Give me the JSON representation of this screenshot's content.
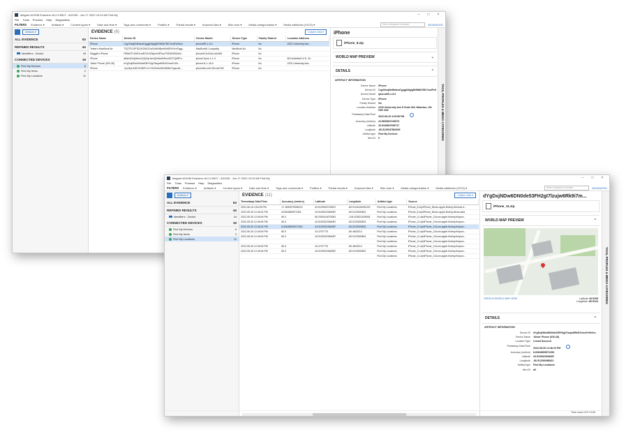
{
  "colors": {
    "accent": "#2a6ebd",
    "selected_row": "#cfe2f7",
    "map_pin": "#d33333"
  },
  "window1": {
    "title": "Magnet AXIOM Examine v6.0.0.5527 - AXIOM - Jun 17 2022 19:10:08 Find My",
    "menu": [
      "File",
      "Tools",
      "Process",
      "Help",
      "Diagnostics"
    ],
    "filters_label": "FILTERS",
    "filters": [
      "Evidence ▾",
      "Artifacts ▾",
      "Content types ▾",
      "Date and time ▾",
      "Tags and comments ▾",
      "Profiles ▾",
      "Partial results ▾",
      "Keyword lists ▾",
      "Skin tone ▾",
      "Media categorization ▾",
      "Media attributes (VICS) ▾"
    ],
    "search_placeholder": "Enter a keyword to search",
    "advanced": "ADVANCED",
    "artifacts_btn": "Artifacts ▾",
    "left": {
      "all_evidence": {
        "label": "ALL EVIDENCE",
        "count": "63"
      },
      "refined": {
        "label": "REFINED RESULTS",
        "count": "44"
      },
      "refined_items": [
        {
          "label": "Identifiers - Device",
          "count": "44"
        }
      ],
      "connected": {
        "label": "CONNECTED DEVICES",
        "count": "19"
      },
      "connected_items": [
        {
          "label": "Find My Devices",
          "count": "6"
        },
        {
          "label": "Find My Items",
          "count": "2"
        },
        {
          "label": "Find My Locations",
          "count": "11"
        }
      ]
    },
    "evidence": {
      "title": "EVIDENCE",
      "count": "(6)",
      "column_view": "Column view ▾",
      "columns": [
        "Device Name",
        "Device ID",
        "Device Model",
        "Device Type",
        "Family Shared",
        "Location Address"
      ],
      "rows": [
        [
          "iPhone",
          "CqyXhsqBnIfhdnaCjyggNiIgIgNHNMk78K7mulFvKkUo",
          "iphone8S-1-9-0",
          "iPhone",
          "No",
          "2220 University Ave..."
        ],
        [
          "Tester's MacBook Air",
          "T2QTSCdPTjDJKZbDJGaGc5hWljmMIx8DVhVrnTogg...",
          "MacBook6,1-capacity",
          "MacBook Air",
          "No",
          ""
        ],
        [
          "Maggie's iPhone",
          "PBWdTCUMGvmB7UUVWjcmV8FtuuTDDW3fXlZw9...",
          "iphone8-3x3x3c-b4e3b8",
          "iPhone",
          "No",
          ""
        ],
        [
          "iPhone",
          "aBah1b2aj3bnoXQQ2yUzmQhi9wsRNvn4ZZTQbRPc...",
          "iphone7plus-1-1-0",
          "iPhone",
          "No",
          "55 Northfield Dr E, W..."
        ],
        [
          "'Alicia' Phone (iOS-28)",
          "dYgDxjNDw0N0de53FH2gI7lzujw6Rk9i7mnsFvKh...",
          "iphone11-1-18-0",
          "iPhone",
          "No",
          "2220 University Ave..."
        ],
        [
          "iPhone",
          "+qVI4pUhW7eHWPcYn+N/2Gs3z5kXAB8eYhgcuvfL...",
          "iphone8s-e4e7e8-e4e7e8",
          "iPhone",
          "No",
          ""
        ]
      ]
    },
    "right": {
      "title": "iPhone",
      "file": "iPhone_8.zip",
      "map_preview": "WORLD MAP PREVIEW",
      "details": "DETAILS",
      "artifact_info": "ARTIFACT INFORMATION",
      "fields": [
        {
          "k": "Device Name",
          "v": "iPhone"
        },
        {
          "k": "Device ID",
          "v": "CqyXhsqBnIfhdnaCjyggNiIgIgNHNMk78K7mulFvKk="
        },
        {
          "k": "Device Model",
          "v": "iphone8S-1-9-0"
        },
        {
          "k": "Device Type",
          "v": "iPhone"
        },
        {
          "k": "Family Shared",
          "v": "No"
        },
        {
          "k": "Location Address",
          "v": "2220 University Ave E Suite 300, Waterloo, ON N2K 0A8"
        },
        {
          "k": "Timestamp Date/Time",
          "v": "2022-06-15 4:29:59 PM"
        },
        {
          "k": "Accuracy (meters)",
          "v": "22.8693837195373"
        },
        {
          "k": "Latitude",
          "v": "43.5169847995717"
        },
        {
          "k": "Longitude",
          "v": "-80.5125947861599"
        },
        {
          "k": "Artifact type",
          "v": "Find My Devices"
        },
        {
          "k": "Item ID",
          "v": "0"
        }
      ]
    },
    "vtab": "TAGS, PROFILES & MEDIA CATEGORIES"
  },
  "window2": {
    "title": "Magnet AXIOM Examine v6.0.0.5527 - AXIOM - Jun 17 2022 19:10:08 Find My",
    "menu": [
      "File",
      "Tools",
      "Process",
      "Help",
      "Diagnostics"
    ],
    "filters_label": "FILTERS",
    "filters": [
      "Evidence ▾",
      "Artifacts ▾",
      "Content types ▾",
      "Date and time ▾",
      "Tags and comments ▾",
      "Profiles ▾",
      "Partial results ▾",
      "Keyword lists ▾",
      "Skin tone ▾",
      "Media categorization ▾",
      "Media attributes (VICS) ▾"
    ],
    "search_placeholder": "Enter a keyword to search",
    "advanced": "ADVANCED",
    "artifacts_btn": "Artifacts ▾",
    "left": {
      "all_evidence": {
        "label": "ALL EVIDENCE",
        "count": "63"
      },
      "refined": {
        "label": "REFINED RESULTS",
        "count": "44"
      },
      "refined_items": [
        {
          "label": "Identifiers - Device",
          "count": "44"
        }
      ],
      "connected": {
        "label": "CONNECTED DEVICES",
        "count": "19"
      },
      "connected_items": [
        {
          "label": "Find My Devices",
          "count": "6"
        },
        {
          "label": "Find My Items",
          "count": "2"
        },
        {
          "label": "Find My Locations",
          "count": "11"
        }
      ]
    },
    "evidence": {
      "title": "EVIDENCE",
      "count": "(11)",
      "column_view": "Column view ▾",
      "columns": [
        "Timestamp Date/Time",
        "Accuracy (meters)",
        "Latitude",
        "Longitude",
        "Artifact type",
        "Source"
      ],
      "rows": [
        [
          "2022-06-16 4:54:06 PM",
          "17.1830579098123",
          "43.5193002749947",
          "-80.5143449451229",
          "Find My Locations",
          "iPhone_8.zip\\iPhone_8\\com.apple.findmy.Devices.d..."
        ],
        [
          "2022-05-30 12:46:22 PM",
          "8.6364869971353",
          "43.5199322364987",
          "-80.5123909821",
          "Find My Locations",
          "iPhone_8.zip\\iPhone_8\\com.apple.findmy.Items.data"
        ],
        [
          "2022-05-30 12:45:49 PM",
          "80.0",
          "55.2050416079081",
          "-118.423521435908",
          "Find My Locations",
          "iPhone_11.zip\\iPhone_11\\com.apple.findmy.fmipcor..."
        ],
        [
          "2022-05-30 12:45:49 PM",
          "80.0",
          "43.5199322364987",
          "-80.5123909821",
          "Find My Locations",
          "iPhone_11.zip\\iPhone_11\\com.apple.findmy.fmipcor..."
        ],
        [
          "2022-05-30 12:46:22 PM",
          "8.63648699971353",
          "43.5199322364987",
          "-80.5123909821",
          "Find My Locations",
          "iPhone_11.zip\\iPhone_11\\com.apple.findmy.fmipcor..."
        ],
        [
          "2022-05-30 12:45:49 PM",
          "80.0",
          "43.4797778",
          "-80.4843214",
          "Find My Locations",
          "iPhone_11.zip\\iPhone_11\\com.apple.findmy.fmipcor..."
        ],
        [
          "2022-05-30 12:45:49 PM",
          "80.0",
          "43.5199322364987",
          "-80.5123909821",
          "Find My Locations",
          "iPhone_11.zip\\iPhone_11\\com.apple.findmy.fmipcor..."
        ],
        [
          "",
          "",
          "",
          "",
          "Find My Locations",
          "iPhone_11.zip\\iPhone_11\\com.apple.findmy.fmipcor..."
        ],
        [
          "2022-05-30 12:45:49 PM",
          "80.0",
          "43.4797778",
          "-80.4843214",
          "Find My Locations",
          "iPhone_11.zip\\iPhone_11\\com.apple.findmy.fmipcor..."
        ],
        [
          "2022-05-30 12:45:49 PM",
          "80.0",
          "43.5199322364987",
          "-80.5123909821",
          "Find My Locations",
          "iPhone_11.zip\\iPhone_11\\com.apple.findmy.fmipcor..."
        ],
        [
          "",
          "",
          "",
          "",
          "Find My Locations",
          "iPhone_11.zip\\iPhone_11\\com.apple.findmy.fmipcor..."
        ]
      ]
    },
    "right": {
      "title": "dYgDxjNDw6DN0de53FH2gI7lzujw6Rk9i7m...",
      "file": "iPhone_11.zip",
      "map_preview": "WORLD MAP PREVIEW",
      "open_map": "OPEN IN WORLD MAP VIEW",
      "lat_label": "Latitude",
      "lat": "43.5159",
      "lon_label": "Longitude",
      "lon": "-80.5124",
      "details": "DETAILS",
      "artifact_info": "ARTIFACT INFORMATION",
      "fields": [
        {
          "k": "Device ID",
          "v": "dYgDxjNDw6DN0de53FH2gI7lzujw6Rk9i7mnsFvKh0e="
        },
        {
          "k": "Device Name",
          "v": "'Alicia' Phone (iOS-28)"
        },
        {
          "k": "Location Type",
          "v": "Crowd Sourced"
        },
        {
          "k": "Timestamp Date/Time",
          "v": "2022-05-30 12:46:22 PM"
        },
        {
          "k": "Accuracy (meters)",
          "v": "8.63648699971353"
        },
        {
          "k": "Latitude",
          "v": "43.5159322364987"
        },
        {
          "k": "Longitude",
          "v": "-80.512390068421"
        },
        {
          "k": "Artifact type",
          "v": "Find My Locations"
        },
        {
          "k": "Item ID",
          "v": "all"
        }
      ]
    },
    "vtab": "TAGS, PROFILES & MEDIA CATEGORIES",
    "status": "Time zone   UTC+0:00"
  }
}
